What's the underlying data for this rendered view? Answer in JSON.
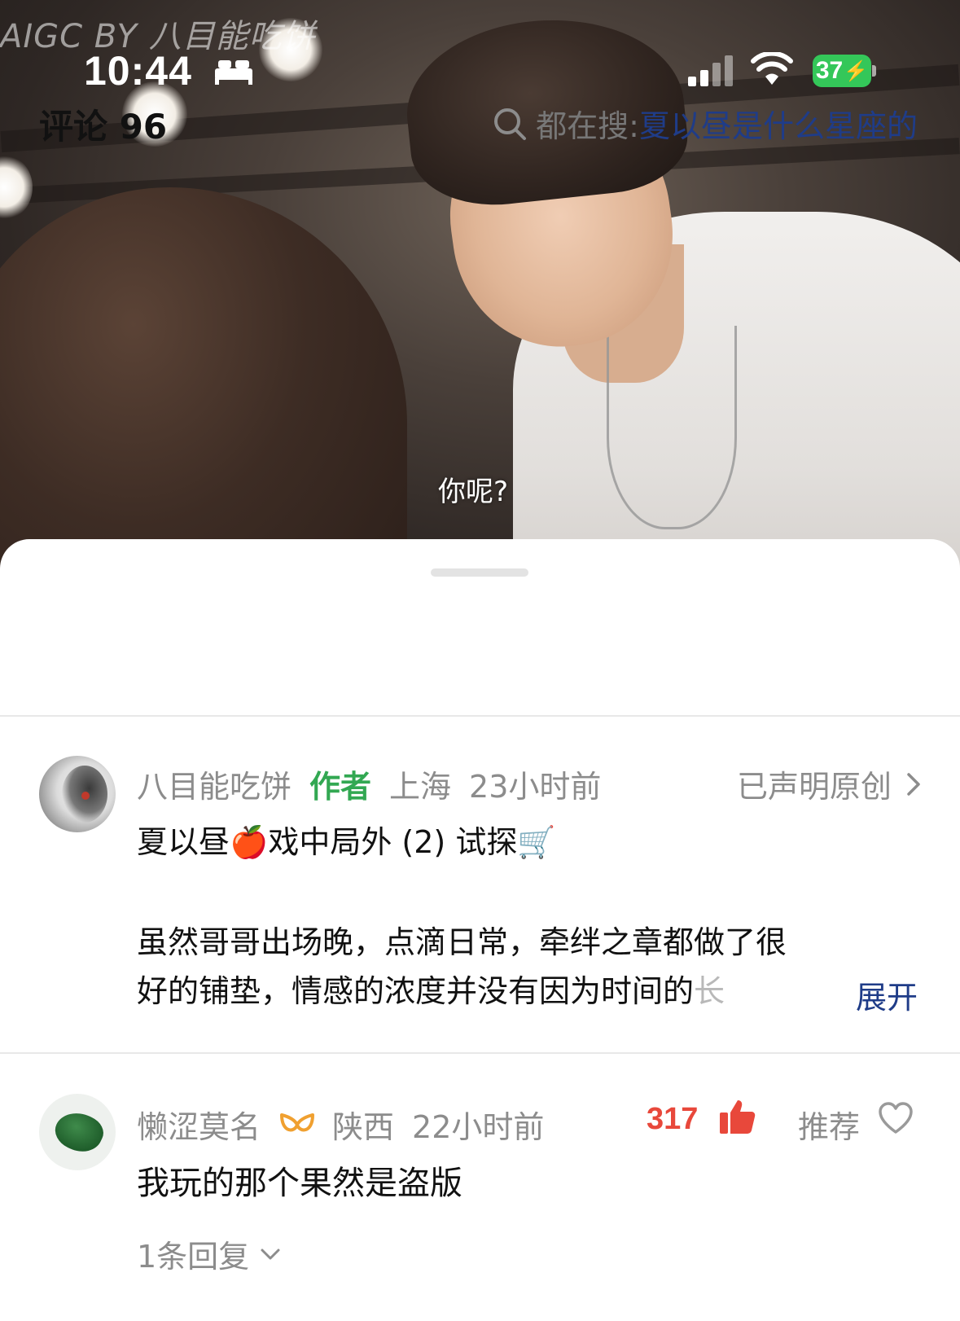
{
  "status_bar": {
    "time": "10:44",
    "battery": "37"
  },
  "video": {
    "watermark": "AIGC BY 八目能吃饼",
    "subtitle": "你呢?"
  },
  "comments_header": {
    "title": "评论 96",
    "search_prefix": "都在搜:",
    "search_term": "夏以昼是什么星座的"
  },
  "post": {
    "author": "八目能吃饼",
    "author_badge": "作者",
    "location": "上海",
    "time": "23小时前",
    "original_label": "已声明原创",
    "title_part1": "夏以昼",
    "title_emoji1": "🍎",
    "title_part2": "戏中局外 (2) 试探",
    "title_emoji2": "🛒",
    "body_line1": "虽然哥哥出场晚，点滴日常，牵绊之章都做了很",
    "body_line2": "好的铺垫，情感的浓度并没有因为时间的",
    "body_line2_fade": "长",
    "expand_label": "展开"
  },
  "comment": {
    "author": "懒涩莫名",
    "location": "陕西",
    "time": "22小时前",
    "likes": "317",
    "recommend_label": "推荐",
    "text": "我玩的那个果然是盗版",
    "replies_label": "1条回复"
  },
  "colors": {
    "accent_blue": "#1f3c88",
    "author_green": "#32a852",
    "like_red": "#e8483b",
    "vip_orange": "#f0a030"
  }
}
